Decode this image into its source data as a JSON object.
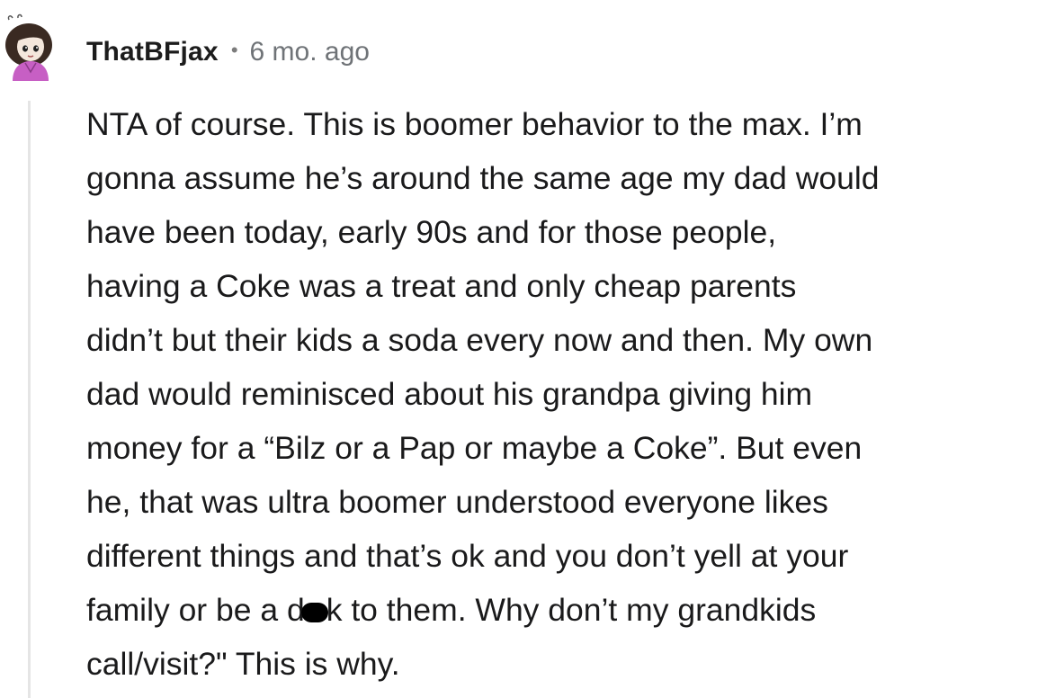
{
  "comment": {
    "username": "ThatBFjax",
    "separator": "•",
    "timestamp": "6 mo. ago",
    "avatar_icon": "user-avatar-icon",
    "body_lines": [
      "NTA of course. This is boomer behavior to the max. I’m",
      "gonna assume he’s around the same age my dad would",
      "have been today, early 90s and for those people,",
      "having a Coke was a treat and only cheap parents",
      "didn’t but their kids a soda every now and then. My own",
      "dad would reminisced about his grandpa giving him",
      "money for a “Bilz or a Pap or maybe a Coke”. But even",
      "he, that was ultra boomer understood everyone likes",
      "different things and that’s ok and you don’t yell at your",
      "family or be a d",
      "k to them. Why don’t my grandkids",
      "call/visit?\" This is why."
    ]
  }
}
